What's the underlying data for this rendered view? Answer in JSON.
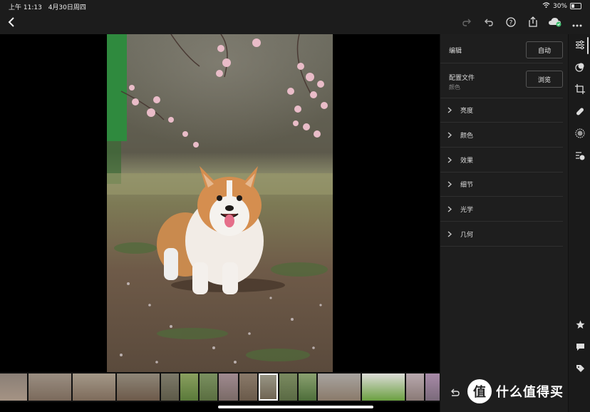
{
  "status": {
    "time": "上午 11:13",
    "date": "4月30日周四",
    "battery": "30%"
  },
  "toolbar": {
    "icons": [
      "back-icon",
      "redo-icon",
      "undo-icon",
      "help-icon",
      "share-icon",
      "cloud-sync-icon",
      "more-icon"
    ]
  },
  "panel": {
    "edit_label": "编辑",
    "auto_button": "自动",
    "profile_label": "配置文件",
    "profile_value": "颜色",
    "browse_button": "浏览",
    "sections": [
      "亮度",
      "颜色",
      "效果",
      "细节",
      "光学",
      "几何"
    ]
  },
  "strip_icons": [
    "sliders-icon",
    "masking-icon",
    "crop-icon",
    "healing-icon",
    "blur-icon",
    "versions-icon",
    "star-icon",
    "comment-icon",
    "tag-icon"
  ],
  "watermark": {
    "logo": "值",
    "text": "什么值得买"
  },
  "colors": {
    "panel_bg": "#1e1e1e",
    "toolbar_bg": "#1c1c1c",
    "accent_green": "#3fbf6f"
  }
}
